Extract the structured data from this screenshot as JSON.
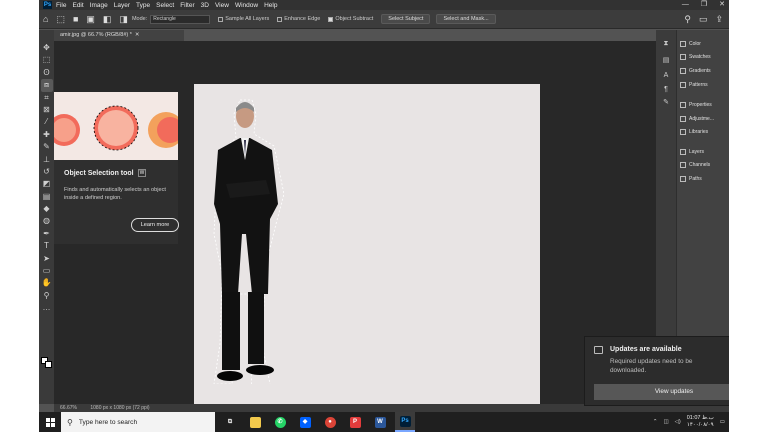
{
  "app": {
    "logo": "Ps",
    "menu": [
      "File",
      "Edit",
      "Image",
      "Layer",
      "Type",
      "Select",
      "Filter",
      "3D",
      "View",
      "Window",
      "Help"
    ],
    "window_controls": [
      "—",
      "❐",
      "✕"
    ]
  },
  "options_bar": {
    "mode_label": "Mode:",
    "mode_value": "Rectangle",
    "sample_all_layers": "Sample All Layers",
    "enhance_edge": "Enhance Edge",
    "object_subtract": "Object Subtract",
    "select_subject": "Select Subject",
    "select_and_mask": "Select and Mask..."
  },
  "document": {
    "tab_title": "amir.jpg @ 66.7% (RGB/8#) *",
    "zoom": "66.67%",
    "size_info": "1080 px x 1080 px (72 ppi)"
  },
  "tooltip": {
    "title": "Object Selection tool",
    "shortcut": "W",
    "description": "Finds and automatically selects an object inside a defined region.",
    "learn_more": "Learn more"
  },
  "panels": [
    {
      "id": "color",
      "label": "Color"
    },
    {
      "id": "swatches",
      "label": "Swatches"
    },
    {
      "id": "gradients",
      "label": "Gradients"
    },
    {
      "id": "patterns",
      "label": "Patterns"
    },
    {
      "id": "properties",
      "label": "Properties"
    },
    {
      "id": "adjustments",
      "label": "Adjustme..."
    },
    {
      "id": "libraries",
      "label": "Libraries"
    },
    {
      "id": "layers",
      "label": "Layers"
    },
    {
      "id": "channels",
      "label": "Channels"
    },
    {
      "id": "paths",
      "label": "Paths"
    }
  ],
  "notification": {
    "title": "Updates are available",
    "body": "Required updates need to be downloaded.",
    "button": "View updates"
  },
  "taskbar": {
    "search_placeholder": "Type here to search",
    "apps": [
      {
        "name": "task-view-icon",
        "glyph": "⧉",
        "color": "#1f1f1f"
      },
      {
        "name": "file-explorer-icon",
        "glyph": "",
        "color": "#f2c94c"
      },
      {
        "name": "whatsapp-icon",
        "glyph": "✆",
        "color": "#25d366"
      },
      {
        "name": "dropbox-icon",
        "glyph": "◆",
        "color": "#0061ff"
      },
      {
        "name": "chrome-icon",
        "glyph": "●",
        "color": "#db4437"
      },
      {
        "name": "app-p-icon",
        "glyph": "P",
        "color": "#e23b3b"
      },
      {
        "name": "word-icon",
        "glyph": "W",
        "color": "#2b579a"
      },
      {
        "name": "photoshop-taskbar-icon",
        "glyph": "Ps",
        "color": "#001e36"
      }
    ],
    "time": "01:07 ب.ظ",
    "date": "۱۴۰۰/۰۸/۰۹"
  },
  "colors": {
    "ps_ui": "#535353",
    "workspace": "#282828",
    "canvas_bg": "#e8e4e4",
    "accent": "#31a8ff"
  }
}
